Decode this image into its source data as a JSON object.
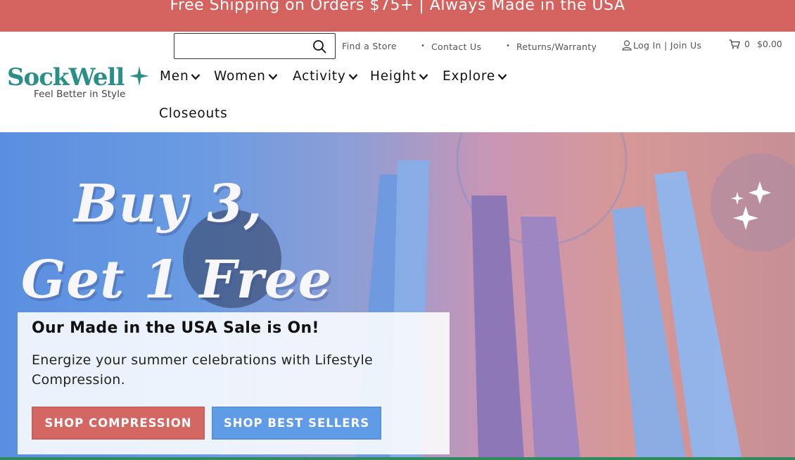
{
  "announcement": {
    "text": "Free Shipping on Orders $75+ | Always Made in the USA"
  },
  "brand": {
    "name": "SockWell",
    "tagline": "Feel Better in Style"
  },
  "search": {
    "placeholder": ""
  },
  "utility_links": {
    "find_store": "Find a Store",
    "contact": "Contact Us",
    "returns": "Returns/Warranty",
    "account": "Log In | Join Us",
    "cart_count": "0",
    "cart_total": "$0.00"
  },
  "nav": {
    "items": [
      {
        "label": "Men"
      },
      {
        "label": "Women"
      },
      {
        "label": "Activity"
      },
      {
        "label": "Height"
      },
      {
        "label": "Explore"
      }
    ],
    "closeouts": "Closeouts"
  },
  "hero": {
    "headline_line1": "Buy 3,",
    "headline_line2": "Get 1 Free",
    "card_title": "Our Made in the USA Sale is On!",
    "card_body": "Energize your summer celebrations with Lifestyle Compression.",
    "cta_primary": "SHOP COMPRESSION",
    "cta_secondary": "SHOP BEST SELLERS"
  },
  "colors": {
    "announcement_bg": "#d4625f",
    "brand_teal": "#2a8f86",
    "cta_red": "#d56763",
    "cta_blue": "#5f9be6"
  }
}
